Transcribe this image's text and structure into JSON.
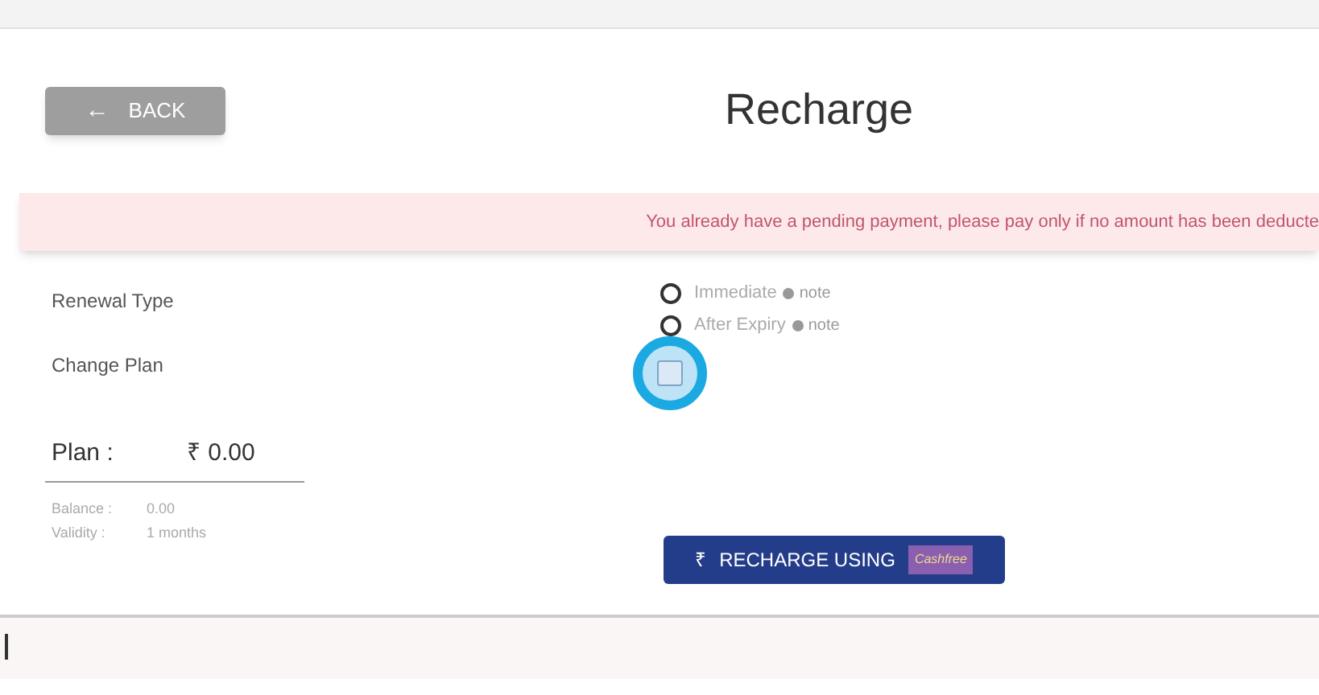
{
  "back_button": {
    "icon": "←",
    "label": "BACK"
  },
  "title": "Recharge",
  "alert": "You already have a pending payment, please pay only if no amount has been deducte",
  "renewal_type": {
    "label": "Renewal Type",
    "options": [
      {
        "label": "Immediate",
        "note": "note",
        "selected": false
      },
      {
        "label": "After Expiry",
        "note": "note",
        "selected": false
      }
    ]
  },
  "change_plan": {
    "label": "Change Plan",
    "checked": false
  },
  "plan": {
    "label": "Plan :",
    "amount": "₹ 0.00",
    "details": [
      {
        "label": "Balance :",
        "value": "0.00"
      },
      {
        "label": "Validity :",
        "value": "1 months"
      }
    ]
  },
  "recharge_button": {
    "icon": "₹",
    "label": "RECHARGE USING",
    "logo_text": "Cashfree"
  }
}
